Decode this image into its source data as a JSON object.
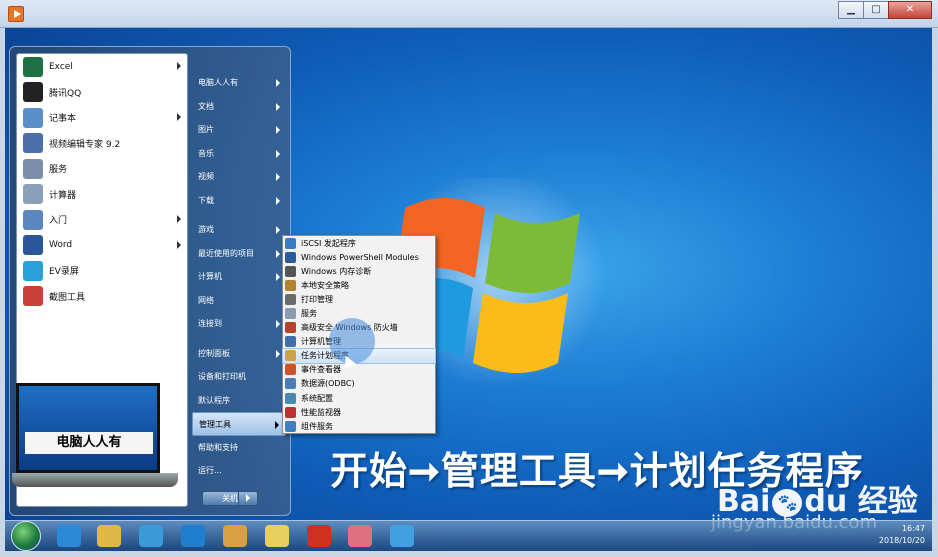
{
  "window": {
    "controls": [
      "▁",
      "□",
      "✕"
    ]
  },
  "programs": [
    {
      "label": "Excel",
      "icon": "excel-icon",
      "color": "#1e7145",
      "arrow": true
    },
    {
      "label": "腾讯QQ",
      "icon": "qq-icon",
      "color": "#222222",
      "arrow": false
    },
    {
      "label": "记事本",
      "icon": "notepad-icon",
      "color": "#5b8fc9",
      "arrow": true
    },
    {
      "label": "视频编辑专家 9.2",
      "icon": "video-editor-icon",
      "color": "#4b6fa8",
      "arrow": false
    },
    {
      "label": "服务",
      "icon": "gears-icon",
      "color": "#7b8fa8",
      "arrow": false
    },
    {
      "label": "计算器",
      "icon": "calculator-icon",
      "color": "#8aa0b8",
      "arrow": false
    },
    {
      "label": "入门",
      "icon": "getting-started-icon",
      "color": "#5b86c0",
      "arrow": true
    },
    {
      "label": "Word",
      "icon": "word-icon",
      "color": "#2b579a",
      "arrow": true
    },
    {
      "label": "EV录屏",
      "icon": "ev-recorder-icon",
      "color": "#2a9fd8",
      "arrow": false
    },
    {
      "label": "截图工具",
      "icon": "snipping-tool-icon",
      "color": "#c9403a",
      "arrow": false
    }
  ],
  "laptop_label": "电脑人人有",
  "places": [
    {
      "label": "电脑人人有",
      "arrow": true,
      "sep": false
    },
    {
      "label": "文档",
      "arrow": true,
      "sep": false
    },
    {
      "label": "图片",
      "arrow": true,
      "sep": false
    },
    {
      "label": "音乐",
      "arrow": true,
      "sep": false
    },
    {
      "label": "视频",
      "arrow": true,
      "sep": false
    },
    {
      "label": "下载",
      "arrow": true,
      "sep": false
    },
    {
      "label": "游戏",
      "arrow": true,
      "sep": true
    },
    {
      "label": "最近使用的项目",
      "arrow": true,
      "sep": false
    },
    {
      "label": "计算机",
      "arrow": true,
      "sep": false
    },
    {
      "label": "网络",
      "arrow": false,
      "sep": false
    },
    {
      "label": "连接到",
      "arrow": true,
      "sep": false
    },
    {
      "label": "控制面板",
      "arrow": true,
      "sep": true
    },
    {
      "label": "设备和打印机",
      "arrow": false,
      "sep": false
    },
    {
      "label": "默认程序",
      "arrow": false,
      "sep": false
    },
    {
      "label": "管理工具",
      "arrow": true,
      "sep": false,
      "active": true
    },
    {
      "label": "帮助和支持",
      "arrow": false,
      "sep": false
    },
    {
      "label": "运行...",
      "arrow": false,
      "sep": false
    }
  ],
  "shutdown_label": "关机",
  "admin_tools": [
    {
      "label": "iSCSI 发起程序",
      "icon": "globe-icon",
      "color": "#3a7bc8"
    },
    {
      "label": "Windows PowerShell Modules",
      "icon": "powershell-icon",
      "color": "#2d5b9a"
    },
    {
      "label": "Windows 内存诊断",
      "icon": "memory-icon",
      "color": "#555555"
    },
    {
      "label": "本地安全策略",
      "icon": "security-policy-icon",
      "color": "#b0832c"
    },
    {
      "label": "打印管理",
      "icon": "printer-icon",
      "color": "#6b6b6b"
    },
    {
      "label": "服务",
      "icon": "gears-icon",
      "color": "#8a9bb0"
    },
    {
      "label": "高级安全 Windows 防火墙",
      "icon": "firewall-icon",
      "color": "#b5432c"
    },
    {
      "label": "计算机管理",
      "icon": "computer-management-icon",
      "color": "#3f6fa8"
    },
    {
      "label": "任务计划程序",
      "icon": "clock-icon",
      "color": "#c9a24a",
      "highlight": true
    },
    {
      "label": "事件查看器",
      "icon": "event-viewer-icon",
      "color": "#c8552d"
    },
    {
      "label": "数据源(ODBC)",
      "icon": "database-icon",
      "color": "#4a7db8"
    },
    {
      "label": "系统配置",
      "icon": "system-config-icon",
      "color": "#4a8ab0"
    },
    {
      "label": "性能监视器",
      "icon": "performance-icon",
      "color": "#c03030"
    },
    {
      "label": "组件服务",
      "icon": "component-services-icon",
      "color": "#4080c0"
    }
  ],
  "watermark": "开始➞管理工具➞计划任务程序",
  "baidu": {
    "bai": "Bai",
    "du": "du",
    "paw": "🐾",
    "jing": "经验",
    "url": "jingyan.baidu.com"
  },
  "taskbar_icons": [
    {
      "icon": "ie-icon",
      "color": "#2a8ad8"
    },
    {
      "icon": "folder-icon",
      "color": "#e0b84a"
    },
    {
      "icon": "network-icon",
      "color": "#3a9ad8"
    },
    {
      "icon": "ie-alt-icon",
      "color": "#1e7fd0"
    },
    {
      "icon": "paint-icon",
      "color": "#d8a040"
    },
    {
      "icon": "sticky-notes-icon",
      "color": "#e8d060"
    },
    {
      "icon": "chess-icon",
      "color": "#d03020"
    },
    {
      "icon": "game-icon",
      "color": "#e07080"
    },
    {
      "icon": "cloud-icon",
      "color": "#40a0e0"
    }
  ],
  "tray": {
    "time": "16:47",
    "date": "2018/10/20"
  }
}
